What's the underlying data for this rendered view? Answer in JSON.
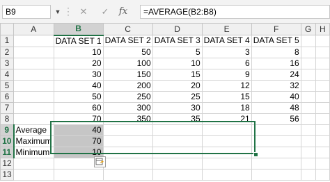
{
  "name_box": {
    "value": "B9"
  },
  "formula_bar": {
    "cancel_icon": "close-icon",
    "enter_icon": "check-icon",
    "fx_label": "fx",
    "formula": "=AVERAGE(B2:B8)"
  },
  "columns": [
    "A",
    "B",
    "C",
    "D",
    "E",
    "F",
    "G",
    "H"
  ],
  "rows": [
    {
      "n": "1",
      "a": "",
      "b": "DATA SET 1",
      "c": "DATA SET 2",
      "d": "DATA SET 3",
      "e": "DATA SET 4",
      "f": "DATA SET 5"
    },
    {
      "n": "2",
      "a": "",
      "b": "10",
      "c": "50",
      "d": "5",
      "e": "3",
      "f": "8"
    },
    {
      "n": "3",
      "a": "",
      "b": "20",
      "c": "100",
      "d": "10",
      "e": "6",
      "f": "16"
    },
    {
      "n": "4",
      "a": "",
      "b": "30",
      "c": "150",
      "d": "15",
      "e": "9",
      "f": "24"
    },
    {
      "n": "5",
      "a": "",
      "b": "40",
      "c": "200",
      "d": "20",
      "e": "12",
      "f": "32"
    },
    {
      "n": "6",
      "a": "",
      "b": "50",
      "c": "250",
      "d": "25",
      "e": "15",
      "f": "40"
    },
    {
      "n": "7",
      "a": "",
      "b": "60",
      "c": "300",
      "d": "30",
      "e": "18",
      "f": "48"
    },
    {
      "n": "8",
      "a": "",
      "b": "70",
      "c": "350",
      "d": "35",
      "e": "21",
      "f": "56"
    },
    {
      "n": "9",
      "a": "Average",
      "b": "40",
      "c": "",
      "d": "",
      "e": "",
      "f": ""
    },
    {
      "n": "10",
      "a": "Maximum",
      "b": "70",
      "c": "",
      "d": "",
      "e": "",
      "f": ""
    },
    {
      "n": "11",
      "a": "Minimum",
      "b": "10",
      "c": "",
      "d": "",
      "e": "",
      "f": ""
    },
    {
      "n": "12",
      "a": "",
      "b": "",
      "c": "",
      "d": "",
      "e": "",
      "f": ""
    },
    {
      "n": "13",
      "a": "",
      "b": "",
      "c": "",
      "d": "",
      "e": "",
      "f": ""
    }
  ],
  "colors": {
    "selection": "#217346",
    "shaded_cell": "#c6c6c6",
    "header_bg": "#f0f0f0"
  },
  "quick_analysis": {
    "icon": "quick-analysis-icon"
  }
}
